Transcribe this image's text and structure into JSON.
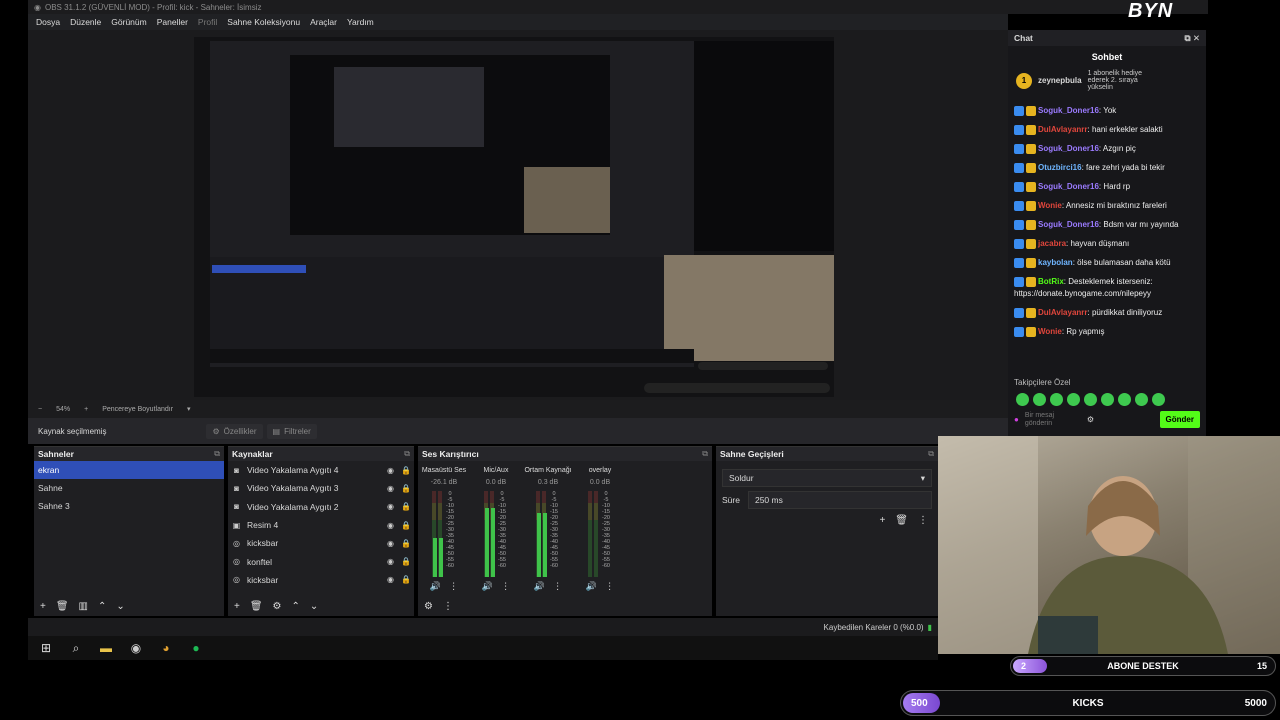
{
  "window": {
    "title": "OBS 31.1.2 (GÜVENLİ MOD) - Profil: kick - Sahneler: İsimsiz"
  },
  "menu": [
    "Dosya",
    "Düzenle",
    "Görünüm",
    "Paneller",
    "Profil",
    "Sahne Koleksiyonu",
    "Araçlar",
    "Yardım"
  ],
  "preview": {
    "zoom": "54%",
    "fit_label": "Pencereye Boyutlandır"
  },
  "source_bar": {
    "status": "Kaynak seçilmemiş",
    "properties": "Özellikler",
    "filters": "Filtreler"
  },
  "scenes": {
    "title": "Sahneler",
    "items": [
      "ekran",
      "Sahne",
      "Sahne 3"
    ],
    "active_index": 0
  },
  "sources": {
    "title": "Kaynaklar",
    "items": [
      {
        "name": "Video Yakalama Aygıtı 4",
        "icon": "camera-icon"
      },
      {
        "name": "Video Yakalama Aygıtı 3",
        "icon": "camera-icon"
      },
      {
        "name": "Video Yakalama Aygıtı 2",
        "icon": "camera-icon"
      },
      {
        "name": "Resim 4",
        "icon": "image-icon"
      },
      {
        "name": "kicksbar",
        "icon": "browser-icon"
      },
      {
        "name": "konftel",
        "icon": "browser-icon"
      },
      {
        "name": "kicksbar",
        "icon": "browser-icon"
      }
    ]
  },
  "mixer": {
    "title": "Ses Karıştırıcı",
    "channels": [
      {
        "name": "Masaüstü Ses",
        "db": "-26.1 dB",
        "level": 0.45
      },
      {
        "name": "Mic/Aux",
        "db": "0.0 dB",
        "level": 0.8
      },
      {
        "name": "Ortam Kaynağı",
        "db": "0.3 dB",
        "level": 0.75
      },
      {
        "name": "overlay",
        "db": "0.0 dB",
        "level": 0.0
      }
    ],
    "ticks": [
      "0",
      "-5",
      "-10",
      "-15",
      "-20",
      "-25",
      "-30",
      "-35",
      "-40",
      "-45",
      "-50",
      "-55",
      "-60"
    ]
  },
  "transitions": {
    "title": "Sahne Geçişleri",
    "selected": "Soldur",
    "duration_label": "Süre",
    "duration_value": "250 ms"
  },
  "status": {
    "dropped": "Kaybedilen Kareler 0 (%0.0)"
  },
  "chat": {
    "panel_title": "Chat",
    "title": "Sohbet",
    "gift_user": "zeynepbula",
    "gift_count": "1",
    "gift_text": "1 abonelik hediye ederek 2. sıraya yükselin",
    "messages": [
      {
        "user": "Soguk_Doner16",
        "color": "#9b7bff",
        "text": "Yok"
      },
      {
        "user": "DulAvlayanrr",
        "color": "#e0463c",
        "text": "hani erkekler salakti"
      },
      {
        "user": "Soguk_Doner16",
        "color": "#9b7bff",
        "text": "Azgın piç"
      },
      {
        "user": "Otuzbirci16",
        "color": "#6fb5ff",
        "text": "fare zehri yada bi tekir"
      },
      {
        "user": "Soguk_Doner16",
        "color": "#9b7bff",
        "text": "Hard rp"
      },
      {
        "user": "Wonie",
        "color": "#e0463c",
        "text": "Annesiz mi bıraktınız fareleri"
      },
      {
        "user": "Soguk_Doner16",
        "color": "#9b7bff",
        "text": "Bdsm var mı yayında"
      },
      {
        "user": "jacabra",
        "color": "#e0463c",
        "text": "hayvan düşmanı"
      },
      {
        "user": "kaybolan",
        "color": "#6fb5ff",
        "text": "ölse bulamasan daha kötü"
      },
      {
        "user": "BotRix",
        "color": "#53fc18",
        "text": "Desteklemek isterseniz: https://donate.bynogame.com/nilepeyy"
      },
      {
        "user": "DulAvlayanrr",
        "color": "#e0463c",
        "text": "pürdikkat diniliyoruz"
      },
      {
        "user": "Wonie",
        "color": "#e0463c",
        "text": "Rp yapmış"
      }
    ],
    "followers_label": "Takipçilere Özel",
    "input_placeholder": "Bir mesaj gönderin",
    "send_label": "Gönder"
  },
  "overlay": {
    "abone_label": "ABONE DESTEK",
    "abone_left": "2",
    "abone_right": "15",
    "abone_progress": 0.13,
    "kicks_label": "KICKS",
    "kicks_left": "500",
    "kicks_right": "5000",
    "kicks_progress": 0.1,
    "logo": "BYN"
  },
  "colors": {
    "accent": "#2f4fb8",
    "kick_green": "#53fc18"
  }
}
